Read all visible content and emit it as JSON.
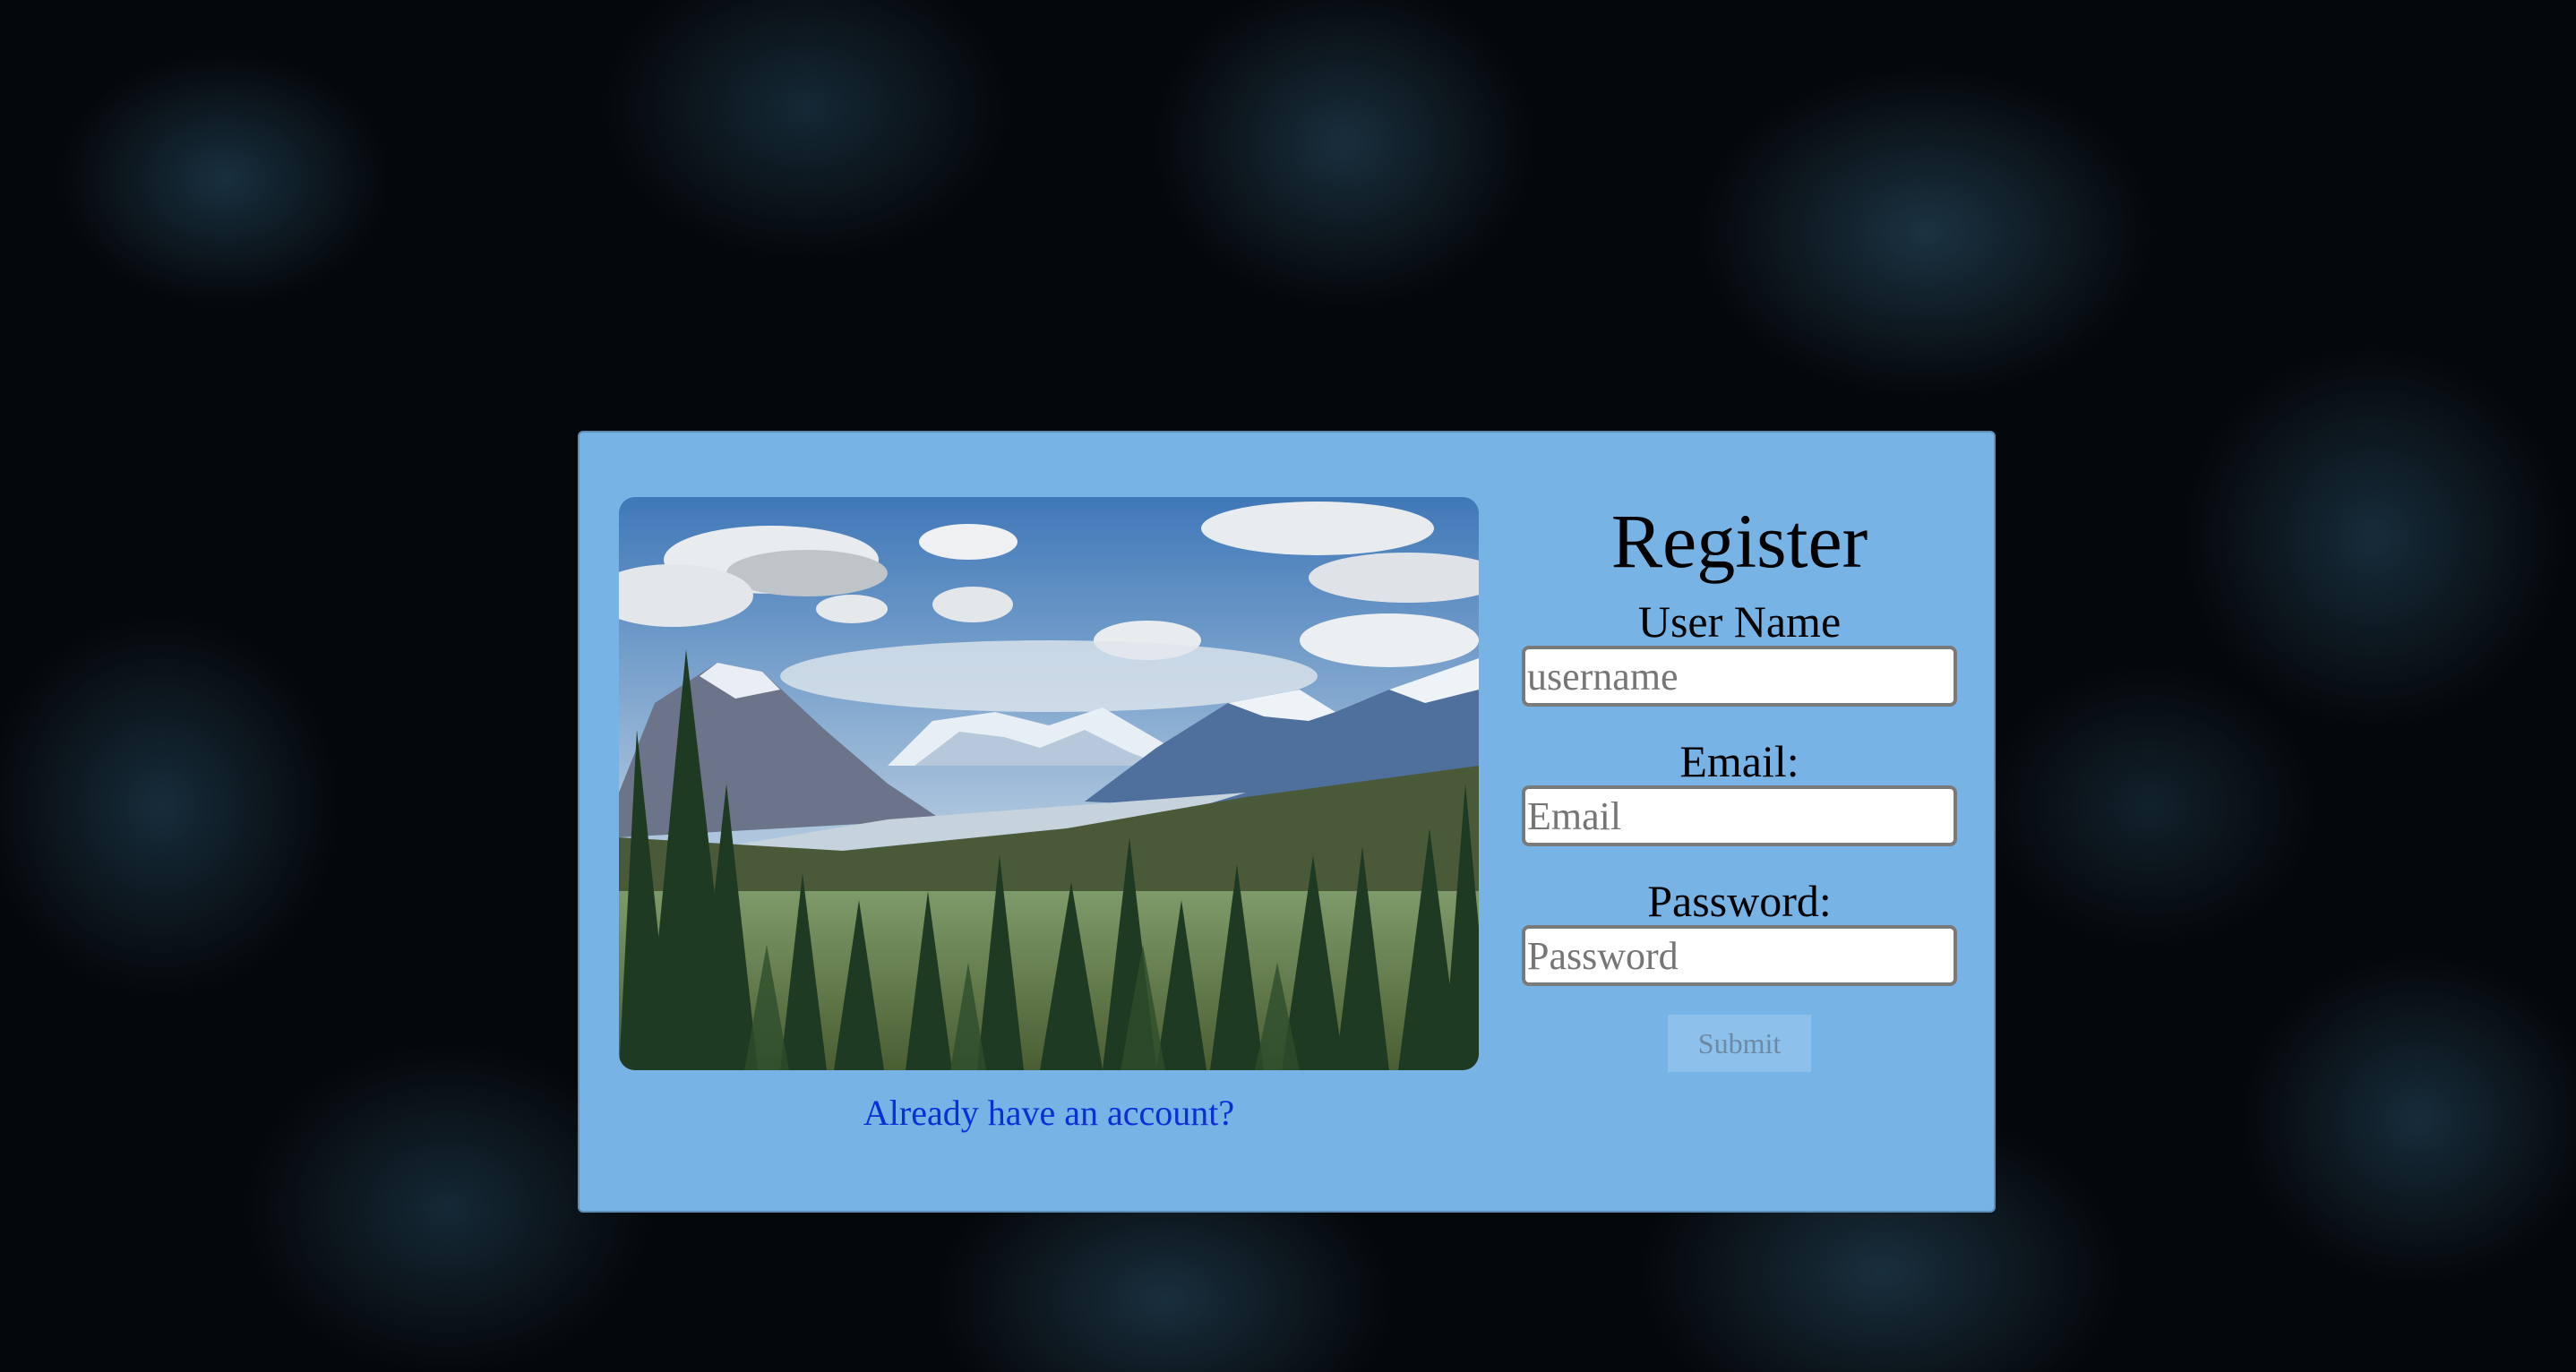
{
  "register": {
    "title": "Register",
    "fields": [
      {
        "label": "User Name",
        "placeholder": "username"
      },
      {
        "label": "Email:",
        "placeholder": "Email"
      },
      {
        "label": "Password:",
        "placeholder": "Password"
      }
    ],
    "submit_label": "Submit",
    "login_link": "Already have an account?"
  },
  "colors": {
    "card_background": "#78b3e6",
    "link": "#0a2fd6",
    "page_background": "#05080b"
  }
}
